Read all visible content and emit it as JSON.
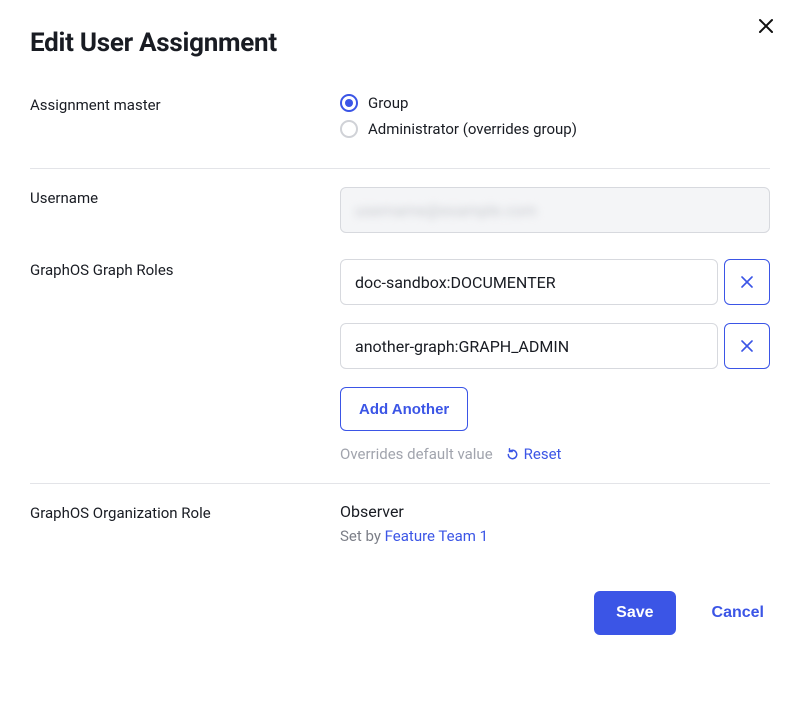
{
  "title": "Edit User Assignment",
  "assignment_master": {
    "label": "Assignment master",
    "options": {
      "group": "Group",
      "admin": "Administrator (overrides group)"
    },
    "selected": "group"
  },
  "username": {
    "label": "Username",
    "value_masked": "username@example.com"
  },
  "graph_roles": {
    "label": "GraphOS Graph Roles",
    "items": [
      "doc-sandbox:DOCUMENTER",
      "another-graph:GRAPH_ADMIN"
    ],
    "add_another_label": "Add Another",
    "override_hint": "Overrides default value",
    "reset_label": "Reset"
  },
  "org_role": {
    "label": "GraphOS Organization Role",
    "value": "Observer",
    "set_by_prefix": "Set by ",
    "set_by_link": "Feature Team 1"
  },
  "buttons": {
    "save": "Save",
    "cancel": "Cancel"
  }
}
